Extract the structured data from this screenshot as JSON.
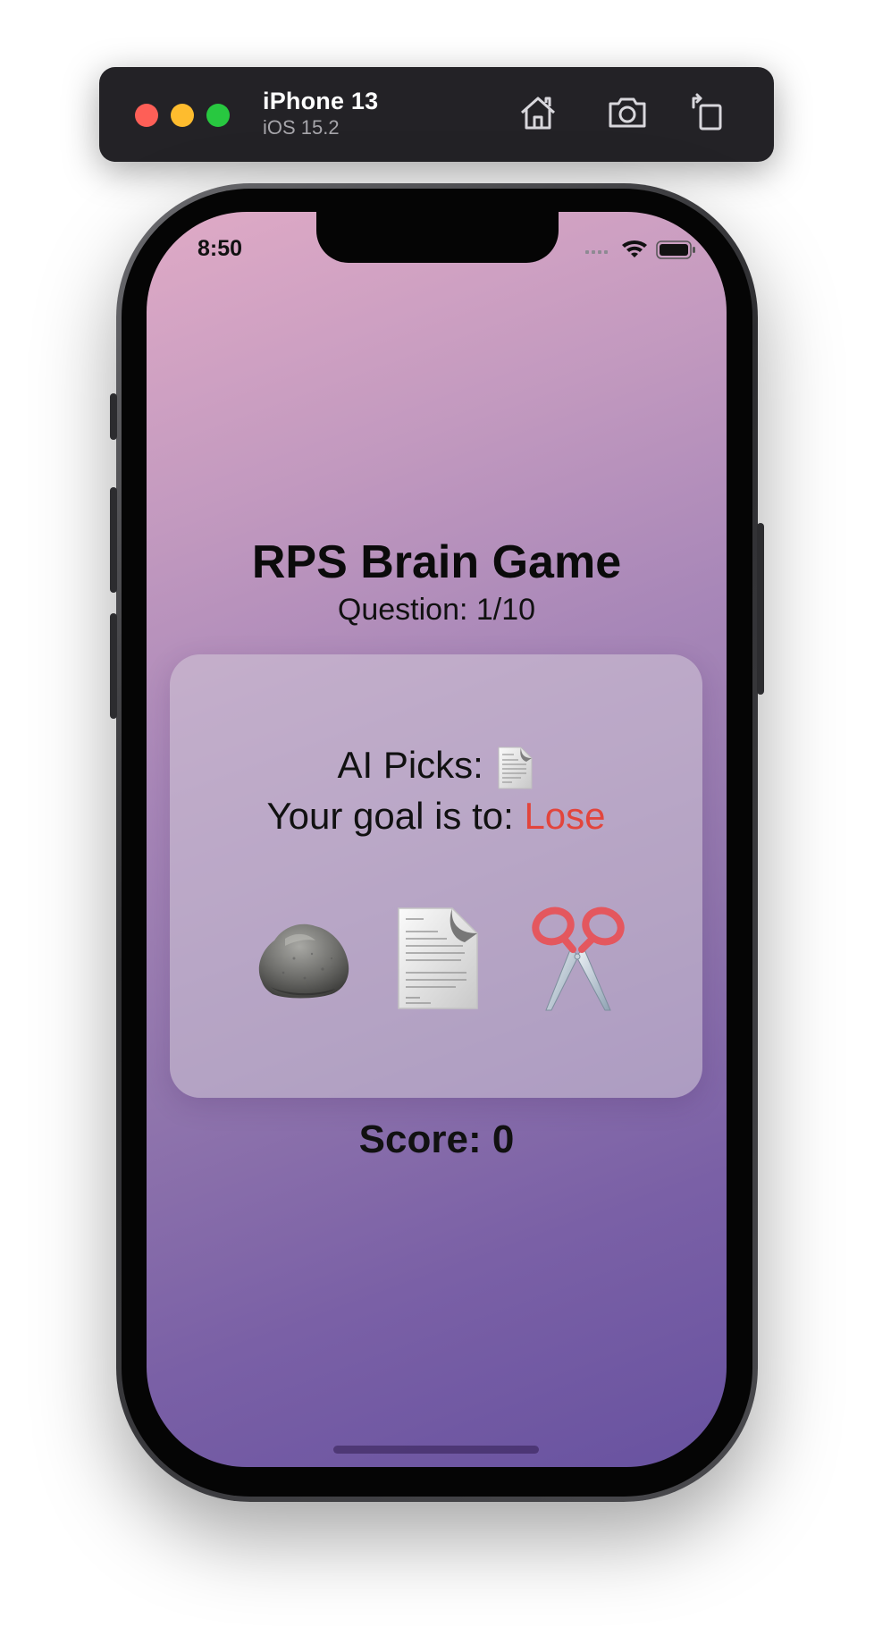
{
  "simulator": {
    "device_name": "iPhone 13",
    "os_version": "iOS 15.2",
    "toolbar_icons": [
      "home-icon",
      "screenshot-icon",
      "rotate-icon"
    ]
  },
  "status_bar": {
    "time": "8:50",
    "icons": [
      "signal-icon",
      "wifi-icon",
      "battery-icon"
    ]
  },
  "game": {
    "title": "RPS Brain Game",
    "question": "Question: 1/10",
    "ai_picks_label": "AI Picks:",
    "ai_pick_icon": "paper-icon",
    "goal_label": "Your goal is to:",
    "goal_value": "Lose",
    "goal_color": "#e2453c",
    "choices": [
      {
        "name": "rock",
        "icon": "rock-icon"
      },
      {
        "name": "paper",
        "icon": "paper-icon"
      },
      {
        "name": "scissors",
        "icon": "scissors-icon"
      }
    ],
    "score": "Score: 0"
  },
  "colors": {
    "gradient_top": "#dfaac6",
    "gradient_bottom": "#6852a0",
    "toolbar_bg": "#232226"
  }
}
